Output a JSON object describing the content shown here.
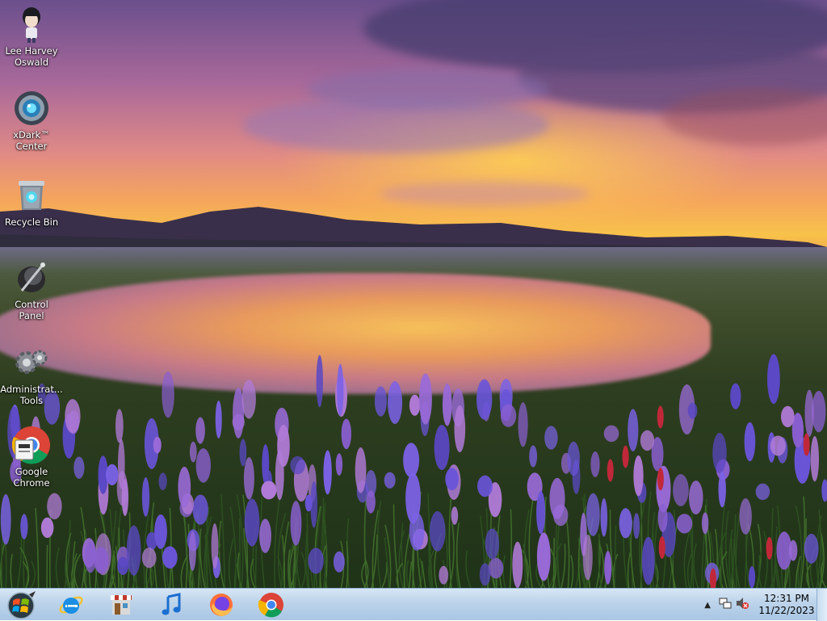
{
  "desktop": {
    "icons": [
      {
        "label": "Lee Harvey\nOswald",
        "icon": "user-avatar-icon"
      },
      {
        "label": "xDark™\nCenter",
        "icon": "xdark-center-icon"
      },
      {
        "label": "Recycle Bin",
        "icon": "recycle-bin-icon"
      },
      {
        "label": "Control Panel",
        "icon": "control-panel-icon"
      },
      {
        "label": "Administrat...\nTools",
        "icon": "admin-tools-icon"
      },
      {
        "label": "Google\nChrome",
        "icon": "chrome-icon"
      }
    ]
  },
  "taskbar": {
    "pinned": [
      "internet-explorer-icon",
      "store-icon",
      "music-icon",
      "firefox-icon",
      "chrome-icon"
    ],
    "clock": {
      "time": "12:31 PM",
      "date": "11/22/2023"
    }
  },
  "colors": {
    "taskbar": "#bcd3ea",
    "label": "#ffffff"
  }
}
